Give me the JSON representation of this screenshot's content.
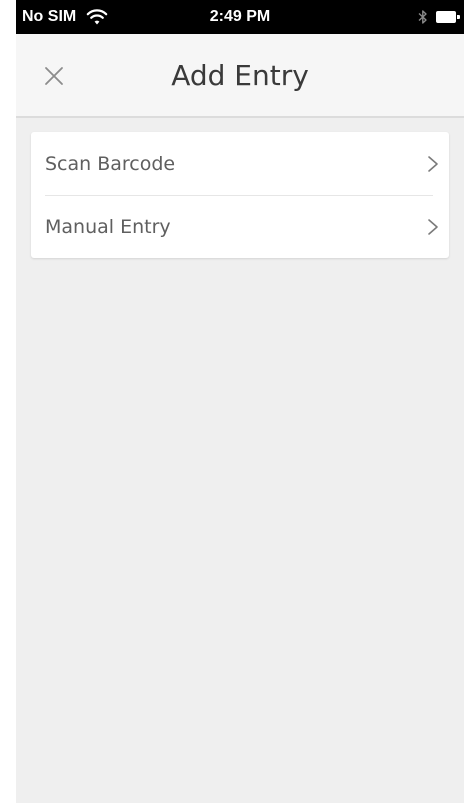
{
  "status_bar": {
    "carrier": "No SIM",
    "time": "2:49 PM",
    "wifi_icon": "wifi-icon",
    "bluetooth_icon": "bluetooth-icon",
    "battery_icon": "battery-icon"
  },
  "nav": {
    "title": "Add Entry",
    "close_icon": "close-icon"
  },
  "options": [
    {
      "label": "Scan Barcode",
      "icon": "chevron-right-icon"
    },
    {
      "label": "Manual Entry",
      "icon": "chevron-right-icon"
    }
  ],
  "colors": {
    "background": "#efefef",
    "status_bar": "#000000",
    "nav_bar": "#f6f6f6",
    "card": "#ffffff",
    "text": "#5f5f5f",
    "title": "#3a3a3a"
  }
}
